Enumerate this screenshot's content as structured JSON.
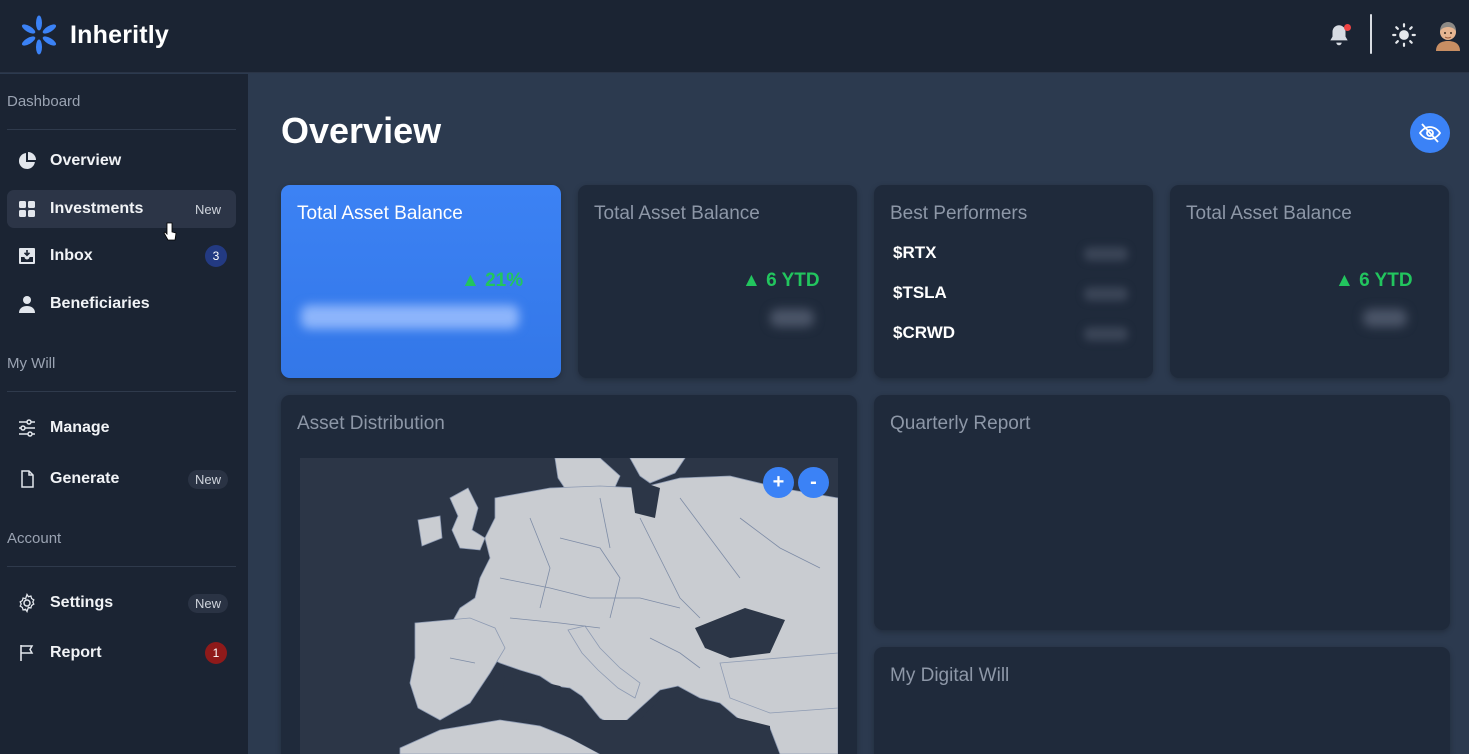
{
  "brand": {
    "name": "Inheritly",
    "accent": "#3b82f6"
  },
  "topbar": {
    "notification_icon": "bell-icon",
    "theme_icon": "sun-icon",
    "avatar_icon": "user-avatar"
  },
  "sidebar": {
    "sections": [
      {
        "title": "Dashboard"
      },
      {
        "title": "My Will"
      },
      {
        "title": "Account"
      }
    ],
    "items": [
      {
        "label": "Overview",
        "icon": "pie-chart-icon"
      },
      {
        "label": "Investments",
        "icon": "grid-icon",
        "tag": "New",
        "active": true
      },
      {
        "label": "Inbox",
        "icon": "inbox-icon",
        "badge": "3"
      },
      {
        "label": "Beneficiaries",
        "icon": "user-icon"
      },
      {
        "label": "Manage",
        "icon": "sliders-icon"
      },
      {
        "label": "Generate",
        "icon": "file-icon",
        "tag": "New"
      },
      {
        "label": "Settings",
        "icon": "gear-icon",
        "tag": "New"
      },
      {
        "label": "Report",
        "icon": "flag-icon",
        "badge": "1"
      }
    ]
  },
  "main": {
    "title": "Overview",
    "cards": [
      {
        "title": "Total Asset Balance",
        "growth": "▲ 21%"
      },
      {
        "title": "Total Asset Balance",
        "growth": "▲ 6 YTD"
      },
      {
        "title": "Best Performers",
        "rows": [
          "$RTX",
          "$TSLA",
          "$CRWD"
        ]
      },
      {
        "title": "Total Asset Balance",
        "growth": "▲ 6 YTD"
      }
    ],
    "panels": {
      "distribution": "Asset Distribution",
      "quarterly": "Quarterly Report",
      "digital_will": "My Digital Will"
    },
    "map": {
      "zoom_in": "+",
      "zoom_out": "-"
    }
  }
}
